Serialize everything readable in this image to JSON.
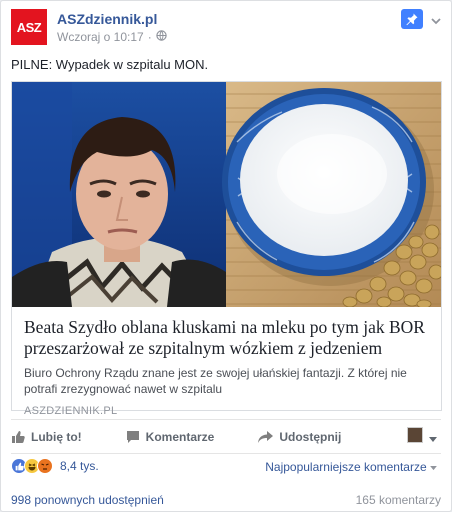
{
  "header": {
    "avatar_text": "ASZ",
    "page_name": "ASZdziennik.pl",
    "timestamp": "Wczoraj o 10:17",
    "separator": "·"
  },
  "post": {
    "text": "PILNE: Wypadek w szpitalu MON."
  },
  "link": {
    "title": "Beata Szydło oblana kluskami na mleku po tym jak BOR przeszarżował ze szpitalnym wózkiem z jedzeniem",
    "description": "Biuro Ochrony Rządu znane jest ze swojej ułańskiej fantazji. Z której nie potrafi zrezygnować nawet w szpitalu",
    "domain": "ASZDZIENNIK.PL"
  },
  "actions": {
    "like": "Lubię to!",
    "comment": "Komentarze",
    "share": "Udostępnij"
  },
  "reactions": {
    "count": "8,4 tys.",
    "sort_label": "Najpopularniejsze komentarze"
  },
  "stats": {
    "shares": "998 ponownych udostępnień",
    "comments": "165 komentarzy"
  },
  "colors": {
    "brand_red": "#e3141f",
    "link_blue": "#365899",
    "pin_blue": "#4080ff"
  }
}
